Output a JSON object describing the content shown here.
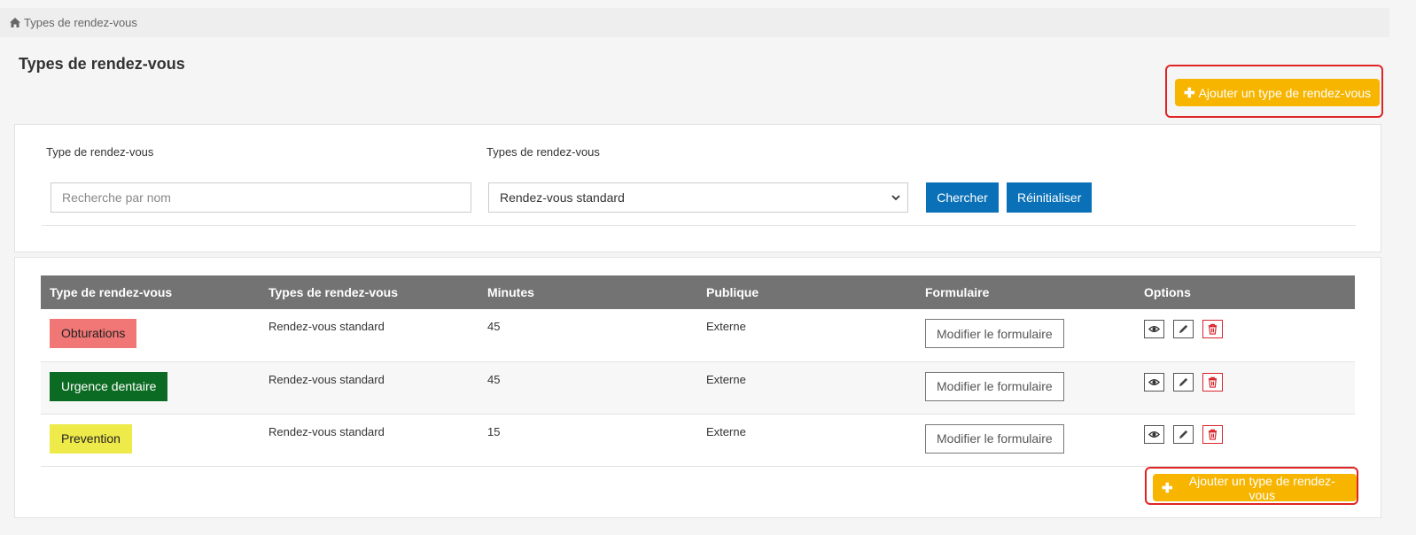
{
  "breadcrumb": {
    "home_icon": "home-icon",
    "label": "Types de rendez-vous"
  },
  "page": {
    "title": "Types de rendez-vous"
  },
  "actions": {
    "add_label": "Ajouter un type de rendez-vous",
    "add_icon": "plus-icon"
  },
  "filters": {
    "name_label": "Type de rendez-vous",
    "name_placeholder": "Recherche par nom",
    "name_value": "",
    "category_label": "Types de rendez-vous",
    "category_selected": "Rendez-vous standard",
    "search_label": "Chercher",
    "reset_label": "Réinitialiser"
  },
  "table": {
    "headers": [
      "Type de rendez-vous",
      "Types de rendez-vous",
      "Minutes",
      "Publique",
      "Formulaire",
      "Options"
    ],
    "rows": [
      {
        "name": "Obturations",
        "color": "#f07775",
        "category": "Rendez-vous standard",
        "minutes": "45",
        "public": "Externe",
        "form_label": "Modifier le formulaire"
      },
      {
        "name": "Urgence dentaire",
        "color": "#0c6b22",
        "category": "Rendez-vous standard",
        "minutes": "45",
        "public": "Externe",
        "form_label": "Modifier le formulaire"
      },
      {
        "name": "Prevention",
        "color": "#eeea4a",
        "category": "Rendez-vous standard",
        "minutes": "15",
        "public": "Externe",
        "form_label": "Modifier le formulaire"
      }
    ],
    "option_icons": [
      "eye-icon",
      "pencil-icon",
      "trash-icon"
    ]
  },
  "colors": {
    "accent": "#f7b500",
    "primary": "#0a70b8",
    "header_bg": "#737373",
    "highlight": "#e02424"
  }
}
